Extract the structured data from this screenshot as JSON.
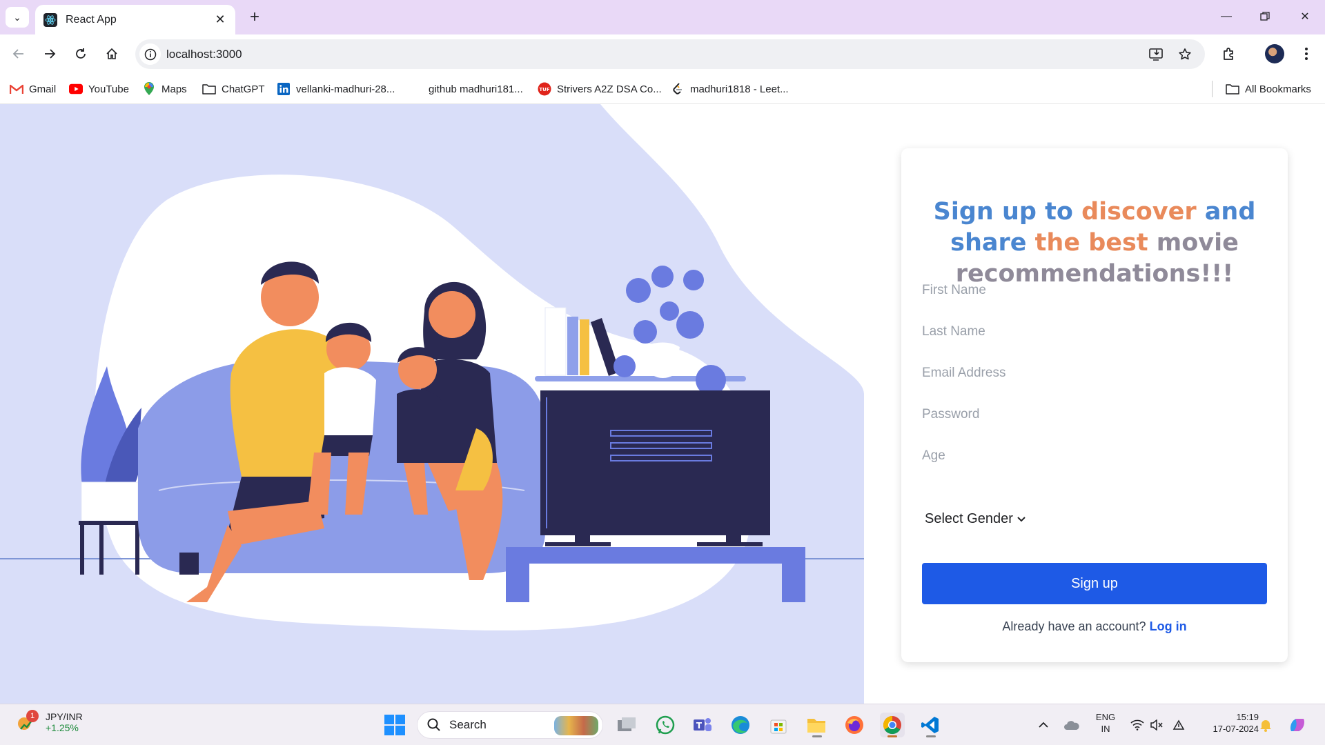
{
  "browser": {
    "tab_title": "React App",
    "new_tab_symbol": "+",
    "url": "localhost:3000",
    "bookmarks": [
      {
        "label": "Gmail",
        "icon": "gmail-icon"
      },
      {
        "label": "YouTube",
        "icon": "youtube-icon"
      },
      {
        "label": "Maps",
        "icon": "maps-icon"
      },
      {
        "label": "ChatGPT",
        "icon": "folder-icon"
      },
      {
        "label": "vellanki-madhuri-28...",
        "icon": "linkedin-icon"
      },
      {
        "label": "github madhuri181...",
        "icon": "none"
      },
      {
        "label": "Strivers A2Z DSA Co...",
        "icon": "tuf-icon"
      },
      {
        "label": "madhuri1818 - Leet...",
        "icon": "leetcode-icon"
      }
    ],
    "all_bookmarks": "All Bookmarks"
  },
  "signup": {
    "heading": {
      "line1": [
        "Sign up to",
        "discover",
        "and"
      ],
      "line2": [
        "share",
        "the best",
        "movie"
      ],
      "line3": "recommendations!!!"
    },
    "fields": [
      {
        "placeholder": "First Name"
      },
      {
        "placeholder": "Last Name"
      },
      {
        "placeholder": "Email Address"
      },
      {
        "placeholder": "Password"
      },
      {
        "placeholder": "Age"
      }
    ],
    "gender_select": "Select Gender",
    "submit": "Sign up",
    "login_prompt": "Already have an account?",
    "login_link": "Log in"
  },
  "taskbar": {
    "ticker": {
      "name": "JPY/INR",
      "change": "+1.25%",
      "badge": "1"
    },
    "search_label": "Search",
    "lang": {
      "line1": "ENG",
      "line2": "IN"
    },
    "time": "15:19",
    "date": "17-07-2024"
  },
  "colors": {
    "accent": "#1e5ae6",
    "heading_blue": "#4a86d0",
    "heading_orange": "#e98a5b",
    "illustration_bg": "#d9def9",
    "tabstrip": "#e9d9f7"
  }
}
